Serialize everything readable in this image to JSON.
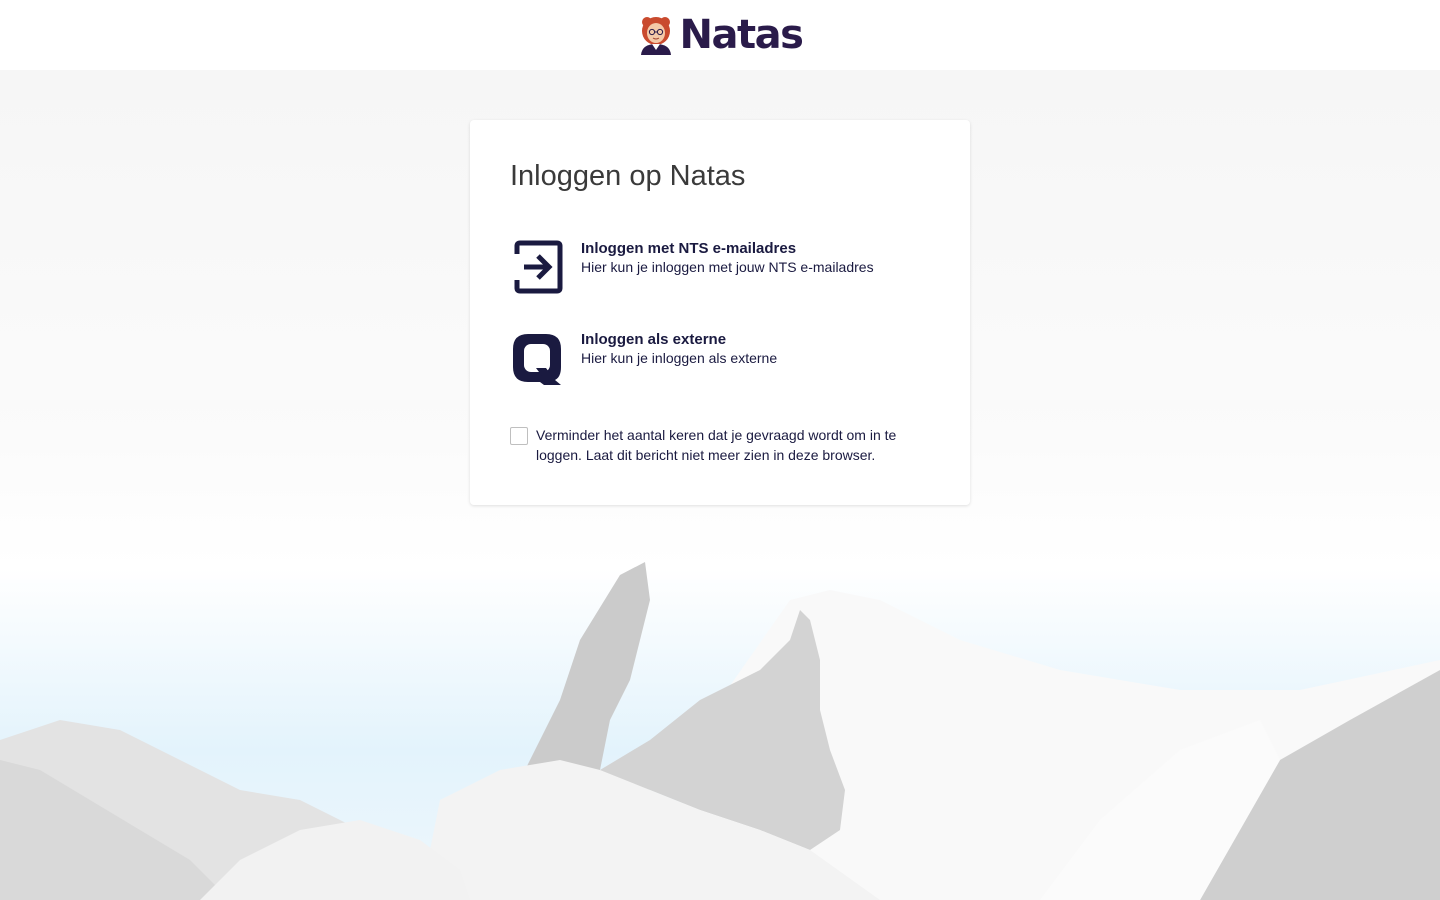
{
  "header": {
    "logo_text": "Natas",
    "logo_icon": "avatar-woman-icon"
  },
  "card": {
    "title": "Inloggen op Natas",
    "options": [
      {
        "icon": "login-arrow-icon",
        "title": "Inloggen met NTS e-mailadres",
        "description": "Hier kun je inloggen met jouw NTS e-mailadres"
      },
      {
        "icon": "q-logo-icon",
        "title": "Inloggen als externe",
        "description": "Hier kun je inloggen als externe"
      }
    ],
    "remember": {
      "checked": false,
      "label": "Verminder het aantal keren dat je gevraagd wordt om in te loggen. Laat dit bericht niet meer zien in deze browser."
    }
  },
  "colors": {
    "brand": "#2a1b4a",
    "icon": "#1a1a40",
    "page_background": "#f6f6f6",
    "sky": "#e3f3fc"
  }
}
